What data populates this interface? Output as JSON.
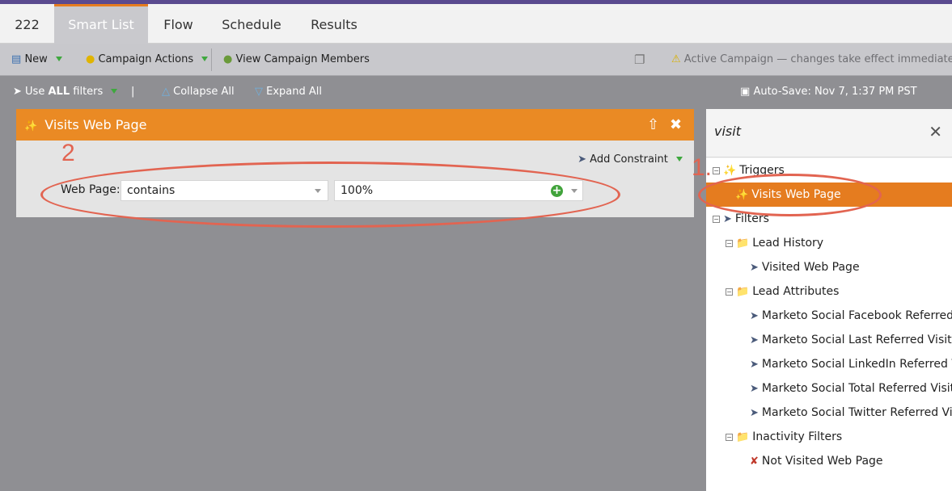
{
  "tabs": [
    {
      "label": "222"
    },
    {
      "label": "Smart List"
    },
    {
      "label": "Flow"
    },
    {
      "label": "Schedule"
    },
    {
      "label": "Results"
    }
  ],
  "toolbar": {
    "new_label": "New",
    "campaign_actions_label": "Campaign Actions",
    "view_members_label": "View Campaign Members",
    "status_text": "Active Campaign — changes take effect immediately"
  },
  "filterbar": {
    "use_all_prefix": "Use",
    "use_all_bold": "ALL",
    "use_all_suffix": "filters",
    "separator": "|",
    "collapse_all": "Collapse All",
    "expand_all": "Expand All",
    "autosave": "Auto-Save: Nov 7, 1:37 PM PST"
  },
  "card": {
    "title": "Visits Web Page",
    "add_constraint": "Add Constraint",
    "row_label": "Web Page:",
    "operator": "contains",
    "value": "100%"
  },
  "annotations": {
    "one": "1.",
    "two": "2"
  },
  "panel": {
    "search_value": "visit",
    "triggers": "Triggers",
    "trigger_item": "Visits Web Page",
    "filters": "Filters",
    "lead_history": "Lead History",
    "visited_web_page": "Visited Web Page",
    "lead_attributes": "Lead Attributes",
    "attr_items": [
      "Marketo Social Facebook Referred Visit",
      "Marketo Social Last Referred Visit",
      "Marketo Social LinkedIn Referred Visit",
      "Marketo Social Total Referred Visits",
      "Marketo Social Twitter Referred Visits"
    ],
    "inactivity_filters": "Inactivity Filters",
    "not_visited": "Not Visited Web Page"
  },
  "colors": {
    "accent_orange": "#ea8a24",
    "annotation_red": "#e26451",
    "brand_purple": "#5a4a8f"
  }
}
